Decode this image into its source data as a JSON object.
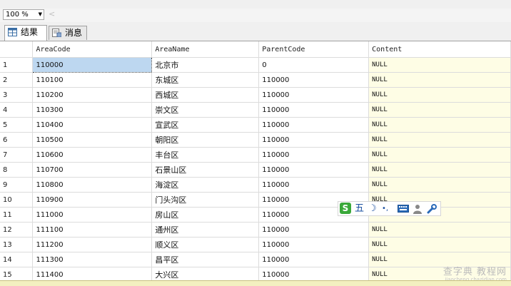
{
  "toolbar": {
    "zoom": "100 %",
    "scroll_left_glyph": "<"
  },
  "tabs": [
    {
      "label": "结果",
      "icon": "grid-icon",
      "active": true
    },
    {
      "label": "消息",
      "icon": "message-icon",
      "active": false
    }
  ],
  "grid": {
    "columns": [
      "AreaCode",
      "AreaName",
      "ParentCode",
      "Content"
    ],
    "rows": [
      [
        "1",
        "110000",
        "北京市",
        "0",
        "NULL"
      ],
      [
        "2",
        "110100",
        "东城区",
        "110000",
        "NULL"
      ],
      [
        "3",
        "110200",
        "西城区",
        "110000",
        "NULL"
      ],
      [
        "4",
        "110300",
        "崇文区",
        "110000",
        "NULL"
      ],
      [
        "5",
        "110400",
        "宣武区",
        "110000",
        "NULL"
      ],
      [
        "6",
        "110500",
        "朝阳区",
        "110000",
        "NULL"
      ],
      [
        "7",
        "110600",
        "丰台区",
        "110000",
        "NULL"
      ],
      [
        "8",
        "110700",
        "石景山区",
        "110000",
        "NULL"
      ],
      [
        "9",
        "110800",
        "海淀区",
        "110000",
        "NULL"
      ],
      [
        "10",
        "110900",
        "门头沟区",
        "110000",
        "NULL"
      ],
      [
        "11",
        "111000",
        "房山区",
        "110000",
        "NULL"
      ],
      [
        "12",
        "111100",
        "通州区",
        "110000",
        "NULL"
      ],
      [
        "13",
        "111200",
        "顺义区",
        "110000",
        "NULL"
      ],
      [
        "14",
        "111300",
        "昌平区",
        "110000",
        "NULL"
      ],
      [
        "15",
        "111400",
        "大兴区",
        "110000",
        "NULL"
      ]
    ]
  },
  "ime": {
    "logo": "S",
    "mode": "五",
    "moon": "☽",
    "punct": "•,",
    "keyboard": "keyboard-icon",
    "user": "user-icon",
    "settings": "wrench-icon"
  },
  "watermark": {
    "main": "查字典 教程网",
    "sub": "jiaocheng.chazidian.com"
  }
}
